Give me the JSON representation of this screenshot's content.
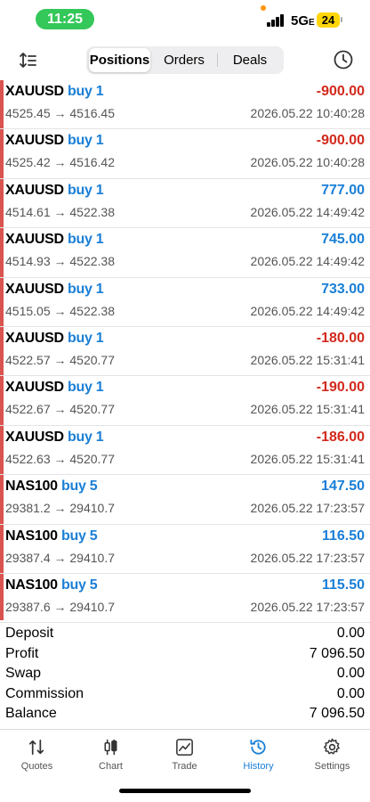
{
  "status_bar": {
    "time": "11:25",
    "network": "5G",
    "network_suffix": "E",
    "battery": "24"
  },
  "top_bar": {
    "tabs": [
      {
        "label": "Positions",
        "active": true
      },
      {
        "label": "Orders",
        "active": false
      },
      {
        "label": "Deals",
        "active": false
      }
    ]
  },
  "deals": [
    {
      "symbol": "XAUUSD",
      "side": "buy 1",
      "profit": "-900.00",
      "sign": "neg",
      "prices": "4525.45 → 4516.45",
      "time": "2026.05.22 10:40:28"
    },
    {
      "symbol": "XAUUSD",
      "side": "buy 1",
      "profit": "-900.00",
      "sign": "neg",
      "prices": "4525.42 → 4516.42",
      "time": "2026.05.22 10:40:28"
    },
    {
      "symbol": "XAUUSD",
      "side": "buy 1",
      "profit": "777.00",
      "sign": "pos",
      "prices": "4514.61 → 4522.38",
      "time": "2026.05.22 14:49:42"
    },
    {
      "symbol": "XAUUSD",
      "side": "buy 1",
      "profit": "745.00",
      "sign": "pos",
      "prices": "4514.93 → 4522.38",
      "time": "2026.05.22 14:49:42"
    },
    {
      "symbol": "XAUUSD",
      "side": "buy 1",
      "profit": "733.00",
      "sign": "pos",
      "prices": "4515.05 → 4522.38",
      "time": "2026.05.22 14:49:42"
    },
    {
      "symbol": "XAUUSD",
      "side": "buy 1",
      "profit": "-180.00",
      "sign": "neg",
      "prices": "4522.57 → 4520.77",
      "time": "2026.05.22 15:31:41"
    },
    {
      "symbol": "XAUUSD",
      "side": "buy 1",
      "profit": "-190.00",
      "sign": "neg",
      "prices": "4522.67 → 4520.77",
      "time": "2026.05.22 15:31:41"
    },
    {
      "symbol": "XAUUSD",
      "side": "buy 1",
      "profit": "-186.00",
      "sign": "neg",
      "prices": "4522.63 → 4520.77",
      "time": "2026.05.22 15:31:41"
    },
    {
      "symbol": "NAS100",
      "side": "buy 5",
      "profit": "147.50",
      "sign": "pos",
      "prices": "29381.2 → 29410.7",
      "time": "2026.05.22 17:23:57"
    },
    {
      "symbol": "NAS100",
      "side": "buy 5",
      "profit": "116.50",
      "sign": "pos",
      "prices": "29387.4 → 29410.7",
      "time": "2026.05.22 17:23:57"
    },
    {
      "symbol": "NAS100",
      "side": "buy 5",
      "profit": "115.50",
      "sign": "pos",
      "prices": "29387.6 → 29410.7",
      "time": "2026.05.22 17:23:57"
    }
  ],
  "summary": [
    {
      "label": "Deposit",
      "value": "0.00"
    },
    {
      "label": "Profit",
      "value": "7 096.50"
    },
    {
      "label": "Swap",
      "value": "0.00"
    },
    {
      "label": "Commission",
      "value": "0.00"
    },
    {
      "label": "Balance",
      "value": "7 096.50"
    }
  ],
  "tab_bar": [
    {
      "label": "Quotes",
      "icon": "quotes-icon",
      "active": false
    },
    {
      "label": "Chart",
      "icon": "chart-icon",
      "active": false
    },
    {
      "label": "Trade",
      "icon": "trade-icon",
      "active": false
    },
    {
      "label": "History",
      "icon": "history-icon",
      "active": true
    },
    {
      "label": "Settings",
      "icon": "settings-icon",
      "active": false
    }
  ],
  "colors": {
    "accent": "#1a7fd6",
    "loss": "#d22a1e",
    "status_green": "#34c759",
    "battery": "#ffd60a",
    "left_bar": "#d9534f"
  }
}
